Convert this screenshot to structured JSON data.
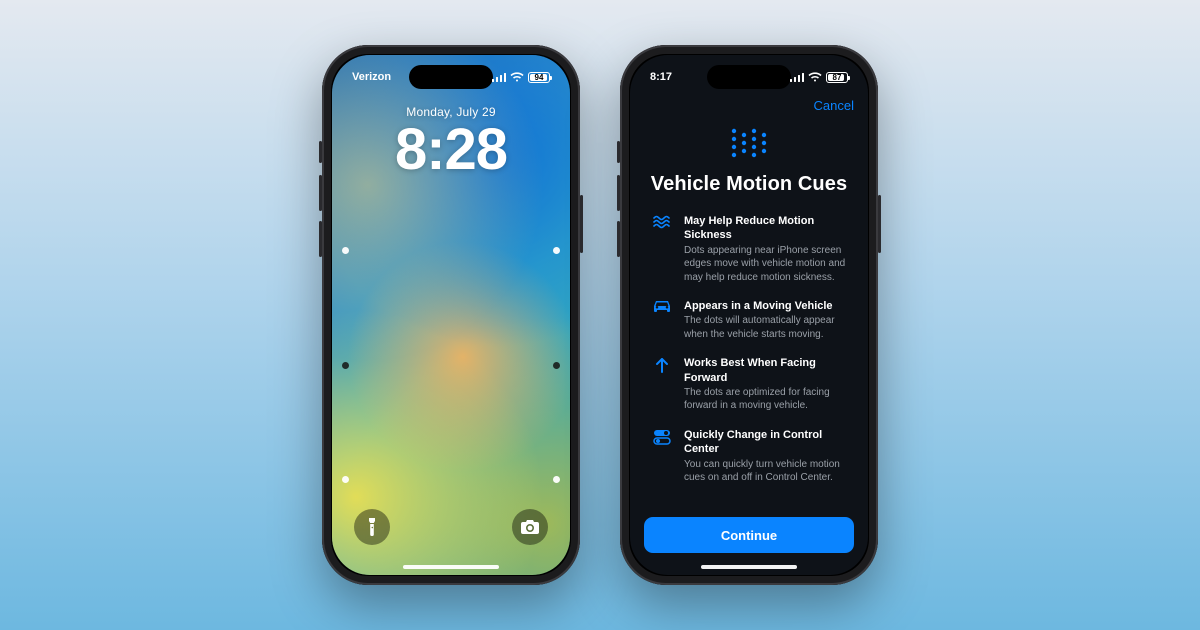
{
  "left_phone": {
    "status": {
      "carrier": "Verizon",
      "battery": "94"
    },
    "lock": {
      "date": "Monday, July 29",
      "time": "8:28"
    },
    "cue_dots": [
      {
        "side": "left",
        "top_pct": 37,
        "tone": "white"
      },
      {
        "side": "right",
        "top_pct": 37,
        "tone": "white"
      },
      {
        "side": "left",
        "top_pct": 59,
        "tone": "dark"
      },
      {
        "side": "right",
        "top_pct": 59,
        "tone": "dark"
      },
      {
        "side": "left",
        "top_pct": 81,
        "tone": "white"
      },
      {
        "side": "right",
        "top_pct": 81,
        "tone": "white"
      }
    ]
  },
  "right_phone": {
    "status": {
      "time": "8:17",
      "battery": "87"
    },
    "cancel": "Cancel",
    "title": "Vehicle Motion Cues",
    "continue": "Continue",
    "features": [
      {
        "icon": "waves",
        "heading": "May Help Reduce Motion Sickness",
        "body": "Dots appearing near iPhone screen edges move with vehicle motion and may help reduce motion sickness."
      },
      {
        "icon": "car",
        "heading": "Appears in a Moving Vehicle",
        "body": "The dots will automatically appear when the vehicle starts moving."
      },
      {
        "icon": "arrow-up",
        "heading": "Works Best When Facing Forward",
        "body": "The dots are optimized for facing forward in a moving vehicle."
      },
      {
        "icon": "toggle",
        "heading": "Quickly Change in Control Center",
        "body": "You can quickly turn vehicle motion cues on and off in Control Center."
      }
    ]
  }
}
